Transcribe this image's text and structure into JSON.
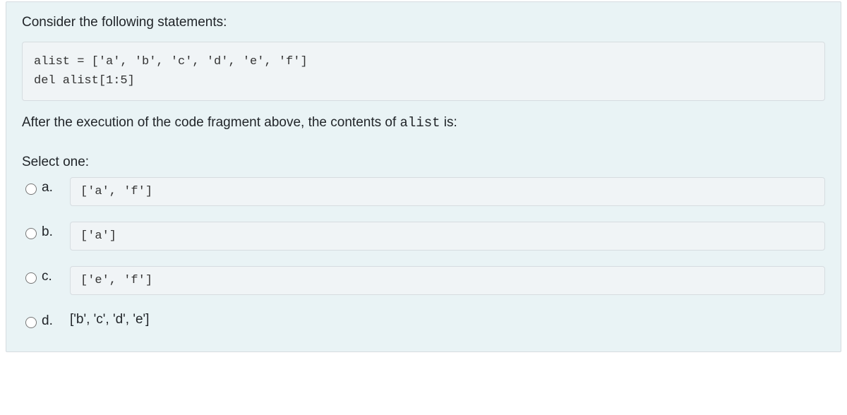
{
  "question": {
    "intro": "Consider the following statements:",
    "code": "alist = ['a', 'b', 'c', 'd', 'e', 'f']\ndel alist[1:5]",
    "after_pre": "After the execution of the code fragment above, the contents of ",
    "after_var": "alist",
    "after_post": " is:",
    "select": "Select one:"
  },
  "options": {
    "a": {
      "letter": "a.",
      "code": "['a', 'f']"
    },
    "b": {
      "letter": "b.",
      "code": "['a']"
    },
    "c": {
      "letter": "c.",
      "code": "['e', 'f']"
    },
    "d": {
      "letter": "d.",
      "text": "['b', 'c', 'd', 'e']"
    }
  }
}
